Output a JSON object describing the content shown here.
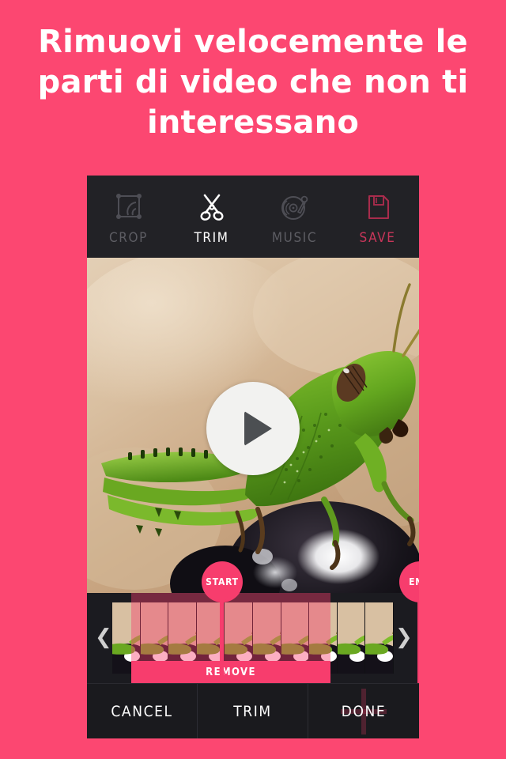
{
  "page": {
    "background_color": "#fc4771",
    "headline": "Rimuovi velocemente le parti di video che non ti interessano"
  },
  "app": {
    "toolbar": {
      "items": [
        {
          "label": "CROP",
          "icon": "crop-icon",
          "state": "inactive",
          "color": "#5d5d63"
        },
        {
          "label": "TRIM",
          "icon": "scissors-icon",
          "state": "active",
          "color": "#ffffff"
        },
        {
          "label": "MUSIC",
          "icon": "vinyl-record-icon",
          "state": "inactive",
          "color": "#5d5d63"
        },
        {
          "label": "SAVE",
          "icon": "floppy-disk-icon",
          "state": "accent",
          "color": "#c9365a"
        }
      ]
    },
    "preview": {
      "play_button": {
        "icon": "play-icon",
        "label": "Play"
      },
      "subject": "green grasshopper on a dark aubergine, blurred beige background"
    },
    "trim": {
      "start_marker_label": "START",
      "end_marker_label": "END",
      "remove_label": "REMOVE",
      "scroll_left_icon": "chevron-left-icon",
      "scroll_right_icon": "chevron-right-icon",
      "selection_color": "#f73d6d",
      "frame_count": 10,
      "selection_start_frame": 1,
      "selection_end_frame": 8
    },
    "actions": [
      {
        "label": "CANCEL",
        "name": "cancel-button"
      },
      {
        "label": "TRIM",
        "name": "trim-button"
      },
      {
        "label": "DONE",
        "name": "done-button"
      }
    ]
  }
}
